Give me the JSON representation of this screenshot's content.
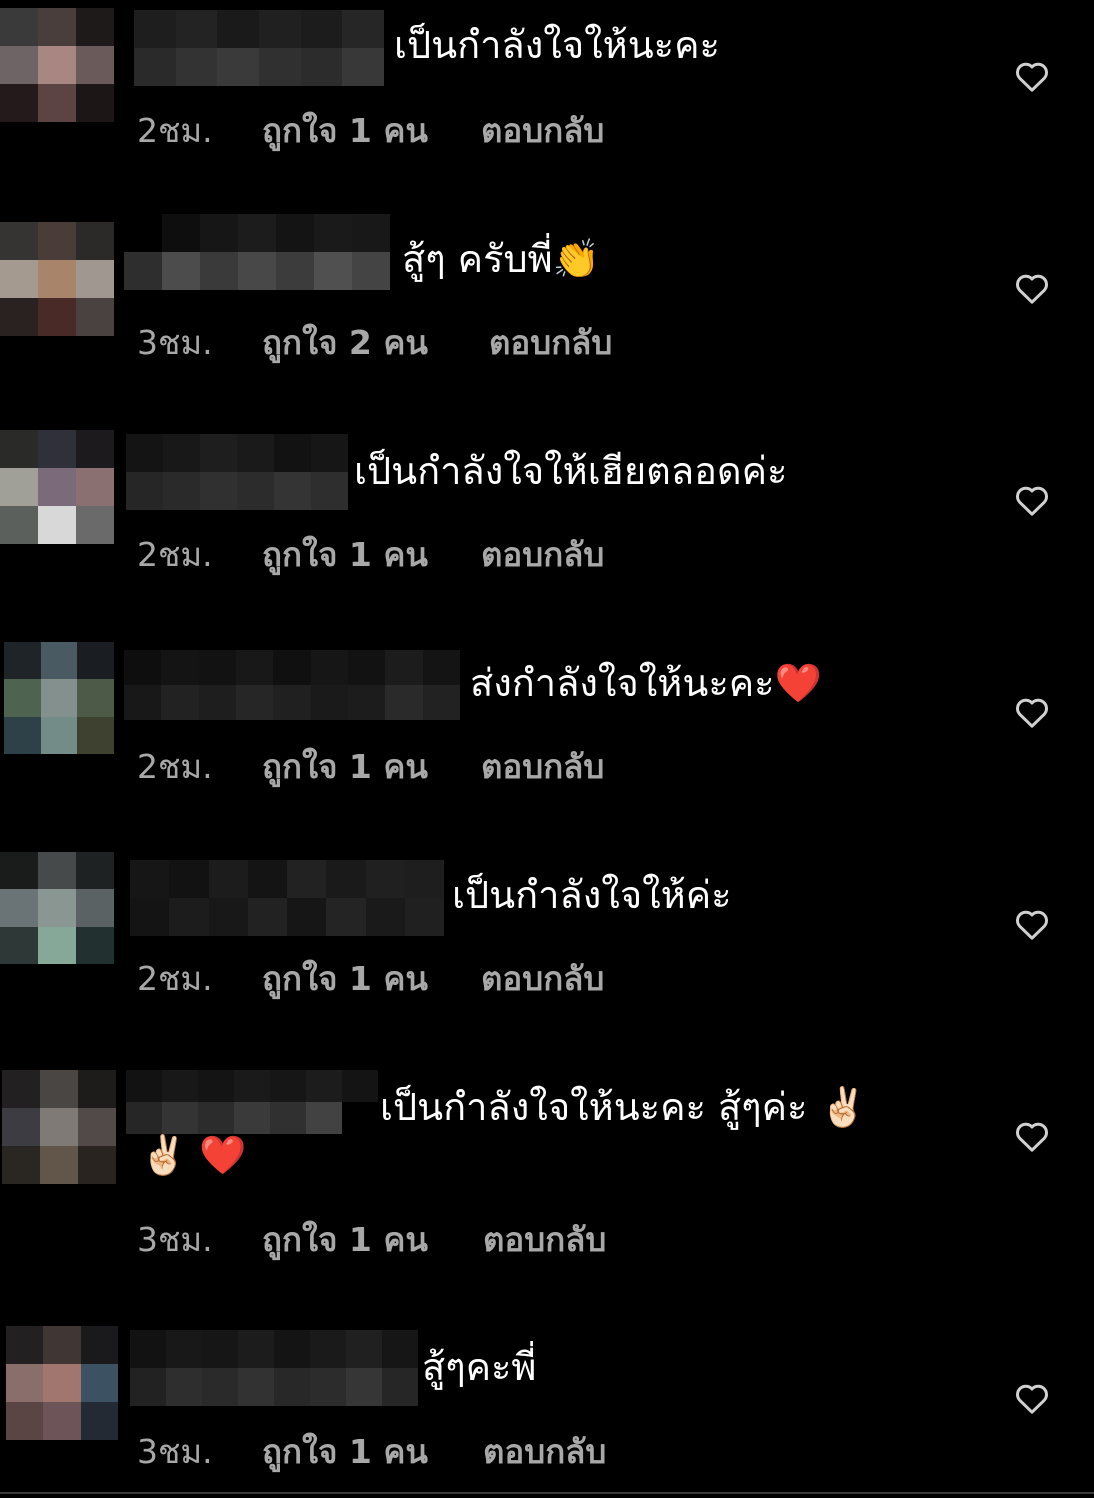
{
  "comments": [
    {
      "text": "เป็นกำลังใจให้นะคะ",
      "time": "2ชม.",
      "likes": "ถูกใจ 1 คน",
      "reply": "ตอบกลับ"
    },
    {
      "text": "สู้ๆ ครับพี่👏",
      "time": "3ชม.",
      "likes": "ถูกใจ 2 คน",
      "reply": "ตอบกลับ"
    },
    {
      "text": "เป็นกำลังใจให้เฮียตลอดค่ะ",
      "time": "2ชม.",
      "likes": "ถูกใจ 1 คน",
      "reply": "ตอบกลับ"
    },
    {
      "text": "ส่งกำลังใจให้นะคะ❤️",
      "time": "2ชม.",
      "likes": "ถูกใจ 1 คน",
      "reply": "ตอบกลับ"
    },
    {
      "text": "เป็นกำลังใจให้ค่ะ",
      "time": "2ชม.",
      "likes": "ถูกใจ 1 คน",
      "reply": "ตอบกลับ"
    },
    {
      "text": "เป็นกำลังใจให้นะคะ สู้ๆค่ะ ✌🏻",
      "text_line2": "✌🏻 ❤️",
      "time": "3ชม.",
      "likes": "ถูกใจ 1 คน",
      "reply": "ตอบกลับ"
    },
    {
      "text": "สู้ๆคะพี่",
      "time": "3ชม.",
      "likes": "ถูกใจ 1 คน",
      "reply": "ตอบกลับ"
    }
  ],
  "icons": {
    "like": "heart-outline-icon"
  },
  "colors": {
    "background": "#000000",
    "text": "#ffffff",
    "meta": "#a8a8a8"
  }
}
